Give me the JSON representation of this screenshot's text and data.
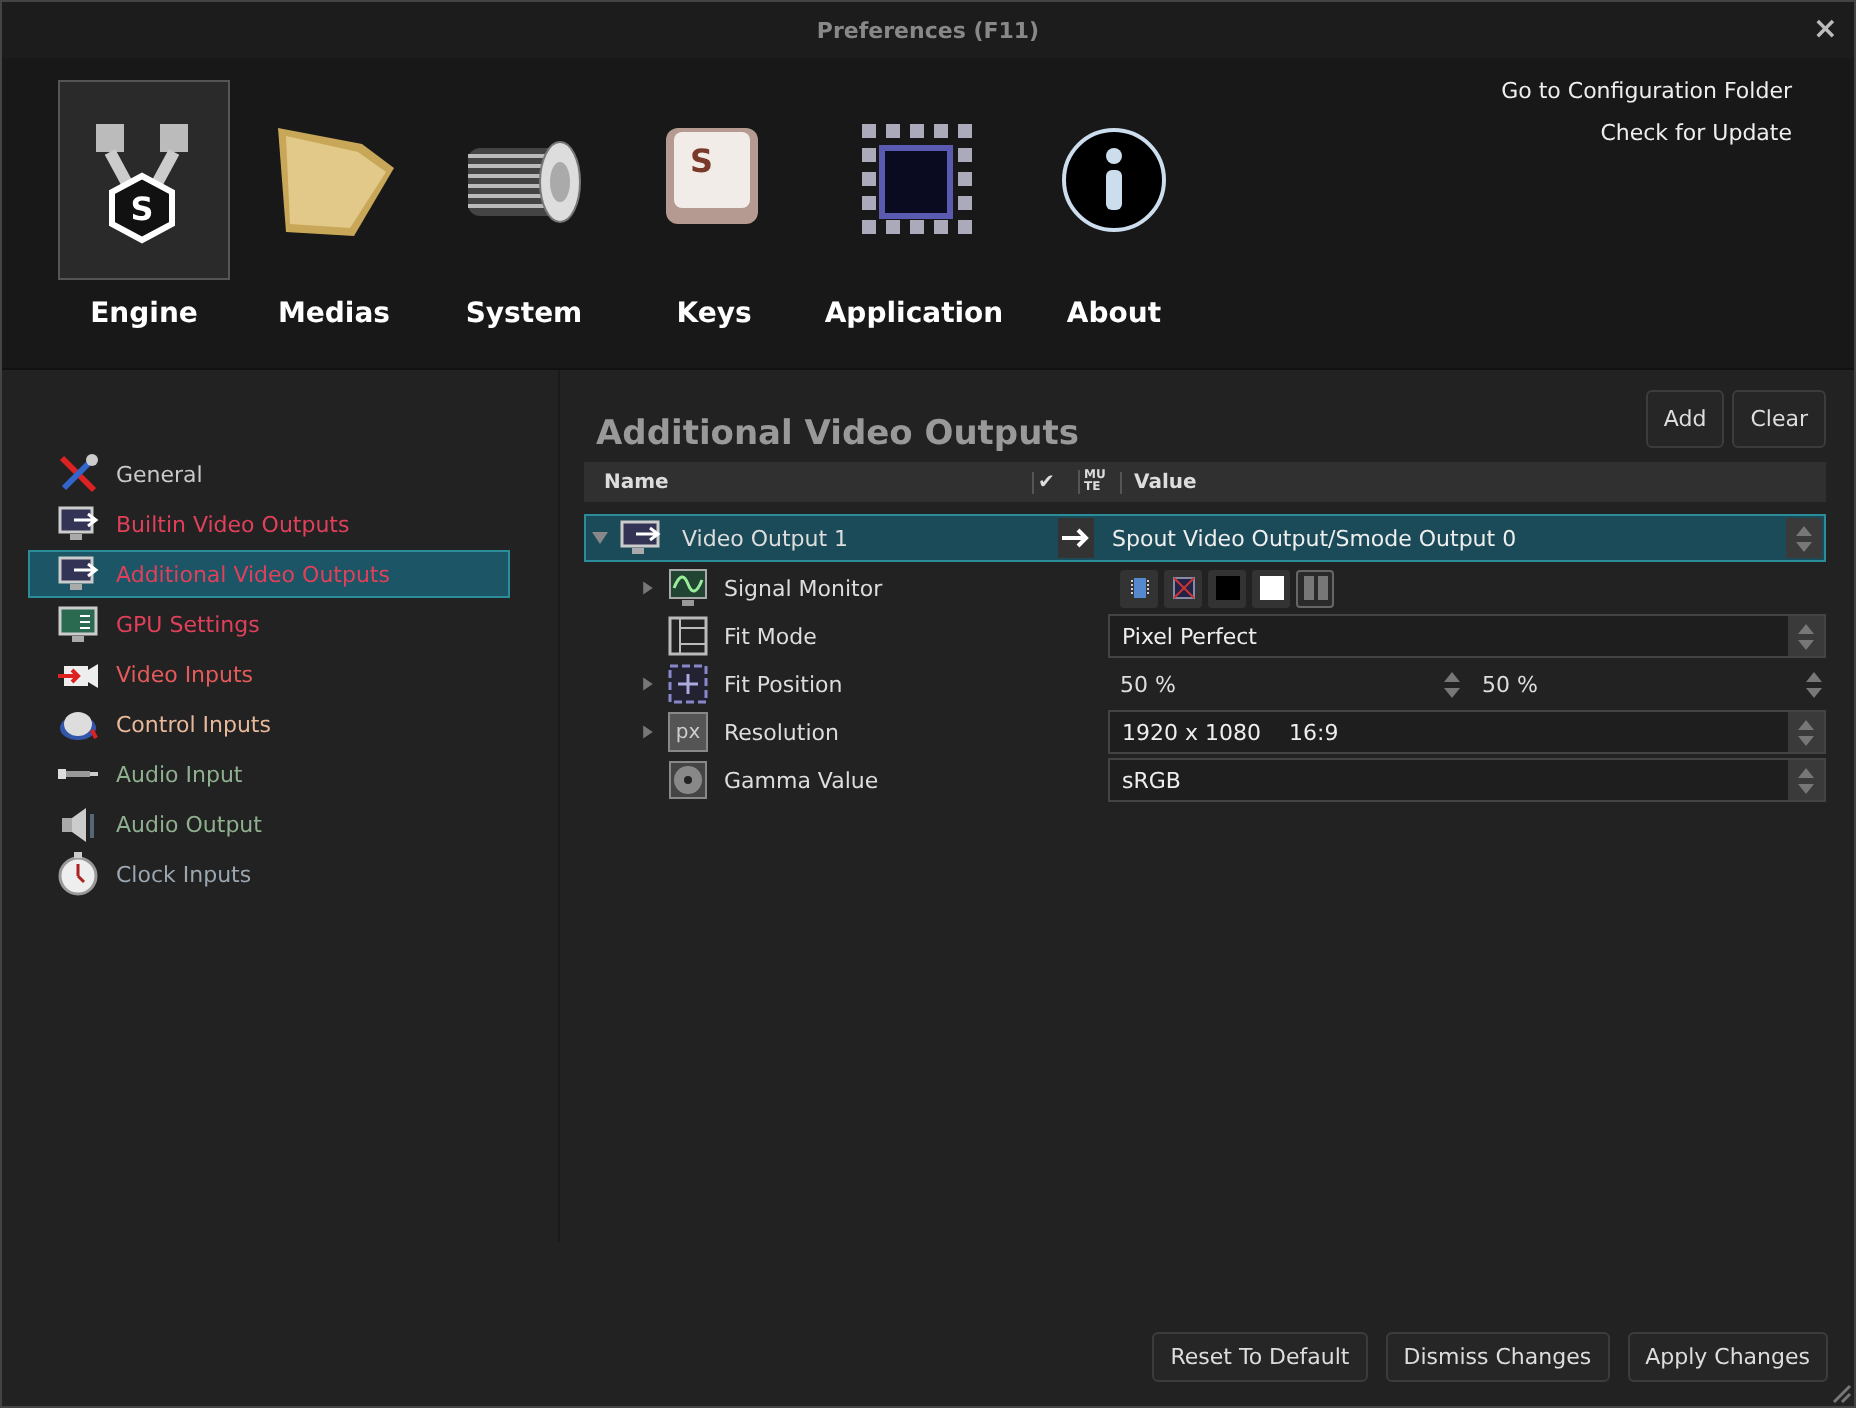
{
  "window": {
    "title": "Preferences (F11)",
    "close": "×"
  },
  "header_tabs": [
    {
      "label": "Engine",
      "kind": "engine",
      "glyph": "S",
      "selected": true
    },
    {
      "label": "Medias",
      "kind": "medias",
      "selected": false
    },
    {
      "label": "System",
      "kind": "system",
      "selected": false
    },
    {
      "label": "Keys",
      "kind": "keys",
      "glyph": "S",
      "selected": false
    },
    {
      "label": "Application",
      "kind": "application",
      "selected": false
    },
    {
      "label": "About",
      "kind": "about",
      "selected": false
    }
  ],
  "header_links": [
    "Go to Configuration Folder",
    "Check for Update"
  ],
  "sidebar": {
    "items": [
      {
        "label": "General",
        "kind": "tools",
        "color": "#c8c8c8",
        "selected": false
      },
      {
        "label": "Builtin Video Outputs",
        "kind": "monitor-arrow",
        "color": "#e0405a",
        "selected": false
      },
      {
        "label": "Additional Video Outputs",
        "kind": "monitor-arrow",
        "color": "#e0405a",
        "selected": true
      },
      {
        "label": "GPU Settings",
        "kind": "monitor-green",
        "color": "#e0405a",
        "selected": false
      },
      {
        "label": "Video Inputs",
        "kind": "camera",
        "color": "#e55a5a",
        "selected": false
      },
      {
        "label": "Control Inputs",
        "kind": "knob",
        "color": "#e8b89a",
        "selected": false
      },
      {
        "label": "Audio Input",
        "kind": "jack",
        "color": "#8fb08f",
        "selected": false
      },
      {
        "label": "Audio Output",
        "kind": "speaker",
        "color": "#8fb08f",
        "selected": false
      },
      {
        "label": "Clock Inputs",
        "kind": "clock",
        "color": "#9aa6b0",
        "selected": false
      }
    ]
  },
  "panel": {
    "title": "Additional Video Outputs",
    "buttons": [
      "Add",
      "Clear"
    ],
    "columns": {
      "name": "Name",
      "check": "✔",
      "mute": "MUTE",
      "value": "Value"
    },
    "tree": [
      {
        "label": "Video Output 1",
        "kind": "dropdown",
        "value": "Spout Video Output/Smode Output 0",
        "expanded": true,
        "selected": true,
        "children": [
          {
            "label": "Signal Monitor",
            "kind": "buttons",
            "expandable": true,
            "expanded": false,
            "buttons": [
              {
                "kind": "film",
                "selected": false
              },
              {
                "kind": "cross",
                "selected": false
              },
              {
                "kind": "black",
                "selected": false
              },
              {
                "kind": "white",
                "selected": false
              },
              {
                "kind": "pause",
                "selected": true
              }
            ]
          },
          {
            "label": "Fit Mode",
            "kind": "dropdown",
            "expandable": false,
            "value": "Pixel Perfect"
          },
          {
            "label": "Fit Position",
            "kind": "pair",
            "expandable": true,
            "expanded": false,
            "values": [
              "50 %",
              "50 %"
            ]
          },
          {
            "label": "Resolution",
            "icon_text": "px",
            "kind": "field",
            "expandable": true,
            "expanded": false,
            "values": [
              "1920 x 1080",
              "16:9"
            ]
          },
          {
            "label": "Gamma Value",
            "kind": "dropdown",
            "expandable": false,
            "value": "sRGB"
          }
        ]
      }
    ]
  },
  "footer_buttons": [
    "Reset To Default",
    "Dismiss Changes",
    "Apply Changes"
  ]
}
